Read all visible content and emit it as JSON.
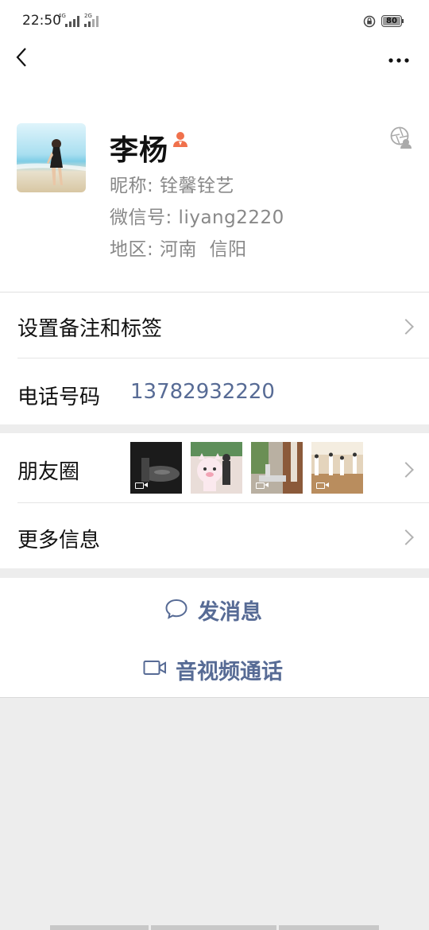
{
  "status_bar": {
    "time": "22:50",
    "network_1": "4G",
    "network_2": "2G",
    "battery": "80"
  },
  "profile": {
    "name": "李杨",
    "nickname": "昵称: 铨馨铨艺",
    "wechat_id": "微信号: liyang2220",
    "region": "地区: 河南  信阳"
  },
  "rows": {
    "remark_tags": "设置备注和标签",
    "phone_label": "电话号码",
    "phone_value": "13782932220",
    "moments": "朋友圈",
    "more_info": "更多信息"
  },
  "actions": {
    "send_message": "发消息",
    "video_call": "音视频通话"
  },
  "colors": {
    "link": "#576b95",
    "background": "#ededed",
    "accent_icon": "#f0714c"
  },
  "icons": [
    "back-icon",
    "more-icon",
    "person-icon",
    "star-friend-icon",
    "chat-bubble-icon",
    "video-camera-icon",
    "chevron-right-icon",
    "video-badge-icon"
  ]
}
